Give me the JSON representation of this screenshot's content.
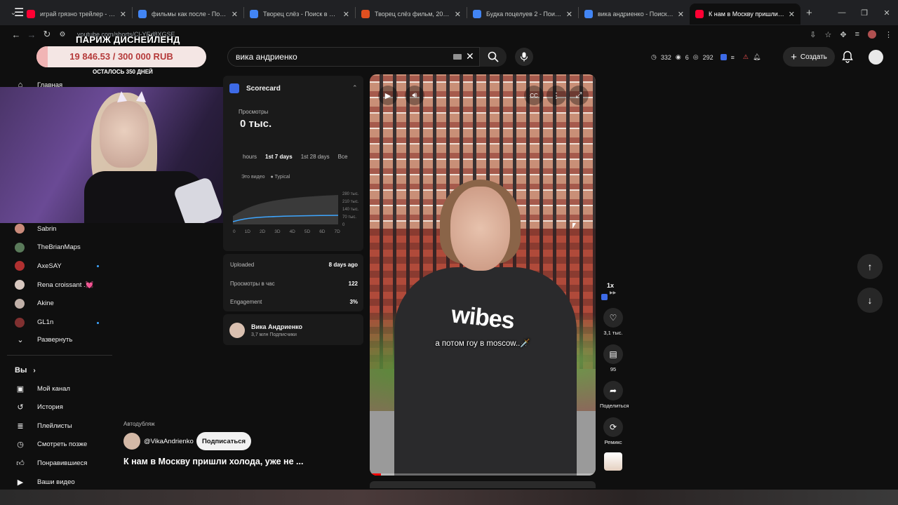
{
  "browser": {
    "tabs": [
      {
        "title": "играй грязно трейлер - YouTube",
        "color": "#ff0033"
      },
      {
        "title": "фильмы как после - Поиск в Google",
        "color": "#4285f4"
      },
      {
        "title": "Творец слёз - Поиск в Google",
        "color": "#4285f4"
      },
      {
        "title": "Творец слёз фильм, 2024, дата",
        "color": "#e05020"
      },
      {
        "title": "Будка поцелуев 2 - Поиск в Google",
        "color": "#4285f4"
      },
      {
        "title": "вика андриенко - Поиск в Google",
        "color": "#4285f4"
      },
      {
        "title": "К нам в Москву пришли холода",
        "color": "#ff0033"
      }
    ],
    "url": "youtube.com/shorts/Cl-YEd8XGSE"
  },
  "overlay": {
    "goal_title": "ПАРИЖ ДИСНЕЙЛЕНД",
    "goal_amount": "19 846.53 / 300 000 RUB",
    "goal_progress": 0.066,
    "days_left": "ОСТАЛОСЬ 350 ДНЕЙ"
  },
  "header": {
    "search_query": "вика андриенко",
    "stats": [
      "332",
      "6",
      "292"
    ],
    "create_label": "Создать"
  },
  "sidebar": {
    "home": "Главная",
    "subscriptions": [
      {
        "name": "Sabrin",
        "color": "#c98a7a",
        "dot": false
      },
      {
        "name": "TheBrianMaps",
        "color": "#5a7a5a",
        "dot": false
      },
      {
        "name": "AxeSAY",
        "color": "#b03030",
        "dot": true
      },
      {
        "name": "Rena croissant .💓",
        "color": "#d8c8c0",
        "dot": false
      },
      {
        "name": "Akine",
        "color": "#c0b0a8",
        "dot": false
      },
      {
        "name": "GL1n",
        "color": "#803030",
        "dot": true
      }
    ],
    "expand": "Развернуть",
    "you": "Вы",
    "you_items": [
      "Мой канал",
      "История",
      "Плейлисты",
      "Смотреть позже",
      "Понравившиеся",
      "Ваши видео"
    ]
  },
  "scorecard": {
    "title": "Scorecard",
    "views_label": "Просмотры",
    "views_value": "0 тыс.",
    "tabs": [
      "hours",
      "1st 7 days",
      "1st 28 days",
      "Все"
    ],
    "legend_this": "Это видео",
    "legend_typical": "Typical",
    "y_ticks": [
      "280 тыс.",
      "210 тыс.",
      "140 тыс.",
      "70 тыс.",
      "0"
    ],
    "x_ticks": [
      "0",
      "1D",
      "2D",
      "3D",
      "4D",
      "5D",
      "6D",
      "7D"
    ],
    "uploaded_label": "Uploaded",
    "uploaded_value": "8 days ago",
    "views_per_hour_label": "Просмотры в час",
    "views_per_hour_value": "122",
    "engagement_label": "Engagement",
    "engagement_value": "3%",
    "channel_name": "Вика Андриенко",
    "channel_subs": "3,7 млн Подписчики"
  },
  "short": {
    "autodub": "Автодубляж",
    "handle": "@VikaAndrienko",
    "subscribe": "Подписаться",
    "title": "К нам в Москву пришли холода, уже не ...",
    "caption": "а потом гоу в moscow..🗡️",
    "shirt_text": "wibes",
    "speed": "1x",
    "likes": "3,1 тыс.",
    "comments": "95",
    "share": "Поделиться",
    "remix": "Ремикс",
    "progress": 0.05
  }
}
